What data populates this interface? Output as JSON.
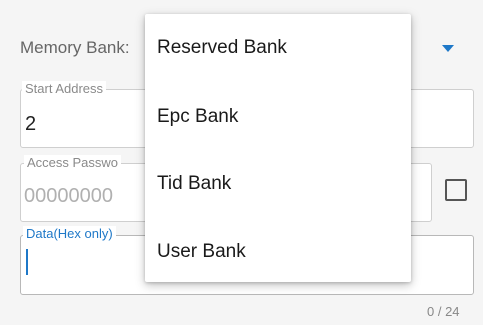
{
  "form": {
    "memory_bank_label": "Memory Bank:",
    "start_address": {
      "legend": "Start Address",
      "value": "2"
    },
    "access_password": {
      "legend": "Access Passwo",
      "value": "00000000"
    },
    "data": {
      "legend": "Data(Hex only)",
      "value": ""
    },
    "counter": "0 / 24"
  },
  "dropdown": {
    "items": [
      "Reserved Bank",
      "Epc Bank",
      "Tid Bank",
      "User Bank"
    ]
  },
  "colors": {
    "accent": "#1e78c8",
    "border": "#cfcfcf",
    "muted_text": "#b0b0b0"
  }
}
